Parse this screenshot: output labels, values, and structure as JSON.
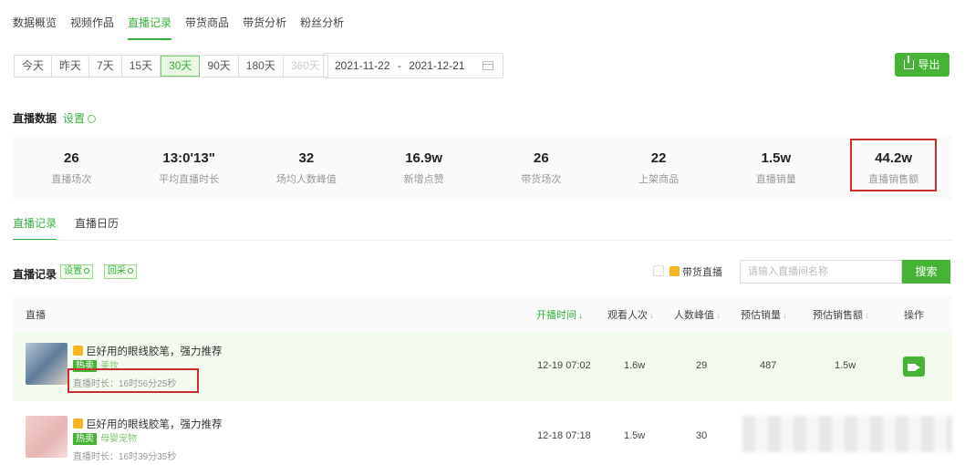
{
  "top_tabs": [
    {
      "label": "数据概览"
    },
    {
      "label": "视频作品"
    },
    {
      "label": "直播记录",
      "active": true
    },
    {
      "label": "带货商品"
    },
    {
      "label": "带货分析"
    },
    {
      "label": "粉丝分析"
    }
  ],
  "range_options": [
    "今天",
    "昨天",
    "7天",
    "15天",
    "30天",
    "90天",
    "180天",
    "360天"
  ],
  "range_selected": "30天",
  "range_disabled": "360天",
  "date_range": {
    "start": "2021-11-22",
    "separator": "-",
    "end": "2021-12-21"
  },
  "export_label": "导出",
  "live_data": {
    "title": "直播数据",
    "settings_label": "设置",
    "stats": [
      {
        "value": "26",
        "label": "直播场次"
      },
      {
        "value": "13:0'13\"",
        "label": "平均直播时长"
      },
      {
        "value": "32",
        "label": "场均人数峰值"
      },
      {
        "value": "16.9w",
        "label": "新增点赞"
      },
      {
        "value": "26",
        "label": "带货场次"
      },
      {
        "value": "22",
        "label": "上架商品"
      },
      {
        "value": "1.5w",
        "label": "直播销量"
      },
      {
        "value": "44.2w",
        "label": "直播销售额"
      }
    ]
  },
  "sub_tabs": [
    {
      "label": "直播记录",
      "active": true
    },
    {
      "label": "直播日历"
    }
  ],
  "records": {
    "title": "直播记录",
    "settings_label": "设置",
    "reset_label": "回采",
    "checkbox_label": "带货直播",
    "search_placeholder": "请输入直播间名称",
    "search_button": "搜索",
    "columns": {
      "live": "直播",
      "start_time": "开播时间",
      "viewers": "观看人次",
      "peak": "人数峰值",
      "sales": "预估销量",
      "revenue": "预估销售额",
      "action": "操作"
    },
    "rows": [
      {
        "title": "巨好用的眼线胶笔，强力推荐",
        "badge": "热卖",
        "category": "美妆",
        "duration": "直播时长：16时56分25秒",
        "start_time": "12-19 07:02",
        "viewers": "1.6w",
        "peak": "29",
        "sales": "487",
        "revenue": "1.5w"
      },
      {
        "title": "巨好用的眼线胶笔，强力推荐",
        "badge": "热卖",
        "category": "母婴宠物",
        "duration": "直播时长：16时39分35秒",
        "start_time": "12-18 07:18",
        "viewers": "1.5w",
        "peak": "30"
      }
    ]
  }
}
